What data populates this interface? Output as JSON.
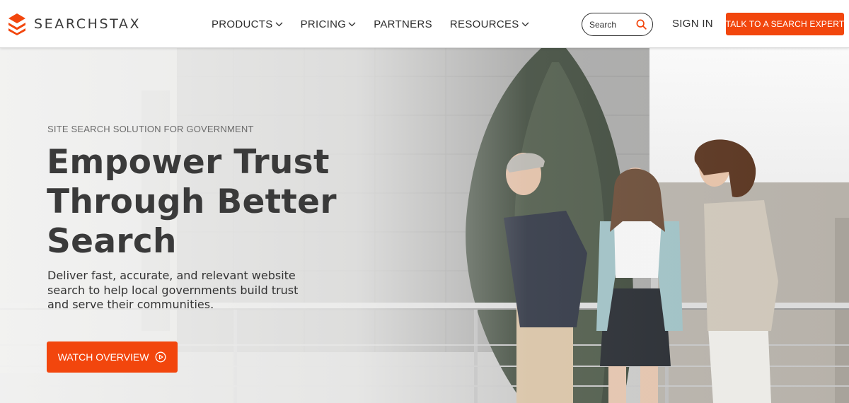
{
  "brand": {
    "name": "SEARCHSTAX",
    "accent_color": "#f2460d"
  },
  "nav": {
    "items": [
      {
        "label": "PRODUCTS",
        "has_dropdown": true
      },
      {
        "label": "PRICING",
        "has_dropdown": true
      },
      {
        "label": "PARTNERS",
        "has_dropdown": false
      },
      {
        "label": "RESOURCES",
        "has_dropdown": true
      }
    ]
  },
  "search": {
    "placeholder": "Search",
    "icon": "search-icon"
  },
  "header": {
    "sign_in_label": "SIGN IN",
    "cta_label": "TALK TO A SEARCH EXPERT"
  },
  "hero": {
    "eyebrow": "SITE SEARCH SOLUTION FOR GOVERNMENT",
    "headline_lines": [
      "Empower Trust",
      "Through Better",
      "Search"
    ],
    "subtext": "Deliver fast, accurate, and relevant website search to help local governments build trust and serve their communities.",
    "button_label": "WATCH OVERVIEW",
    "button_icon": "play-circle-icon",
    "image_description_icon": "hero-photo"
  }
}
